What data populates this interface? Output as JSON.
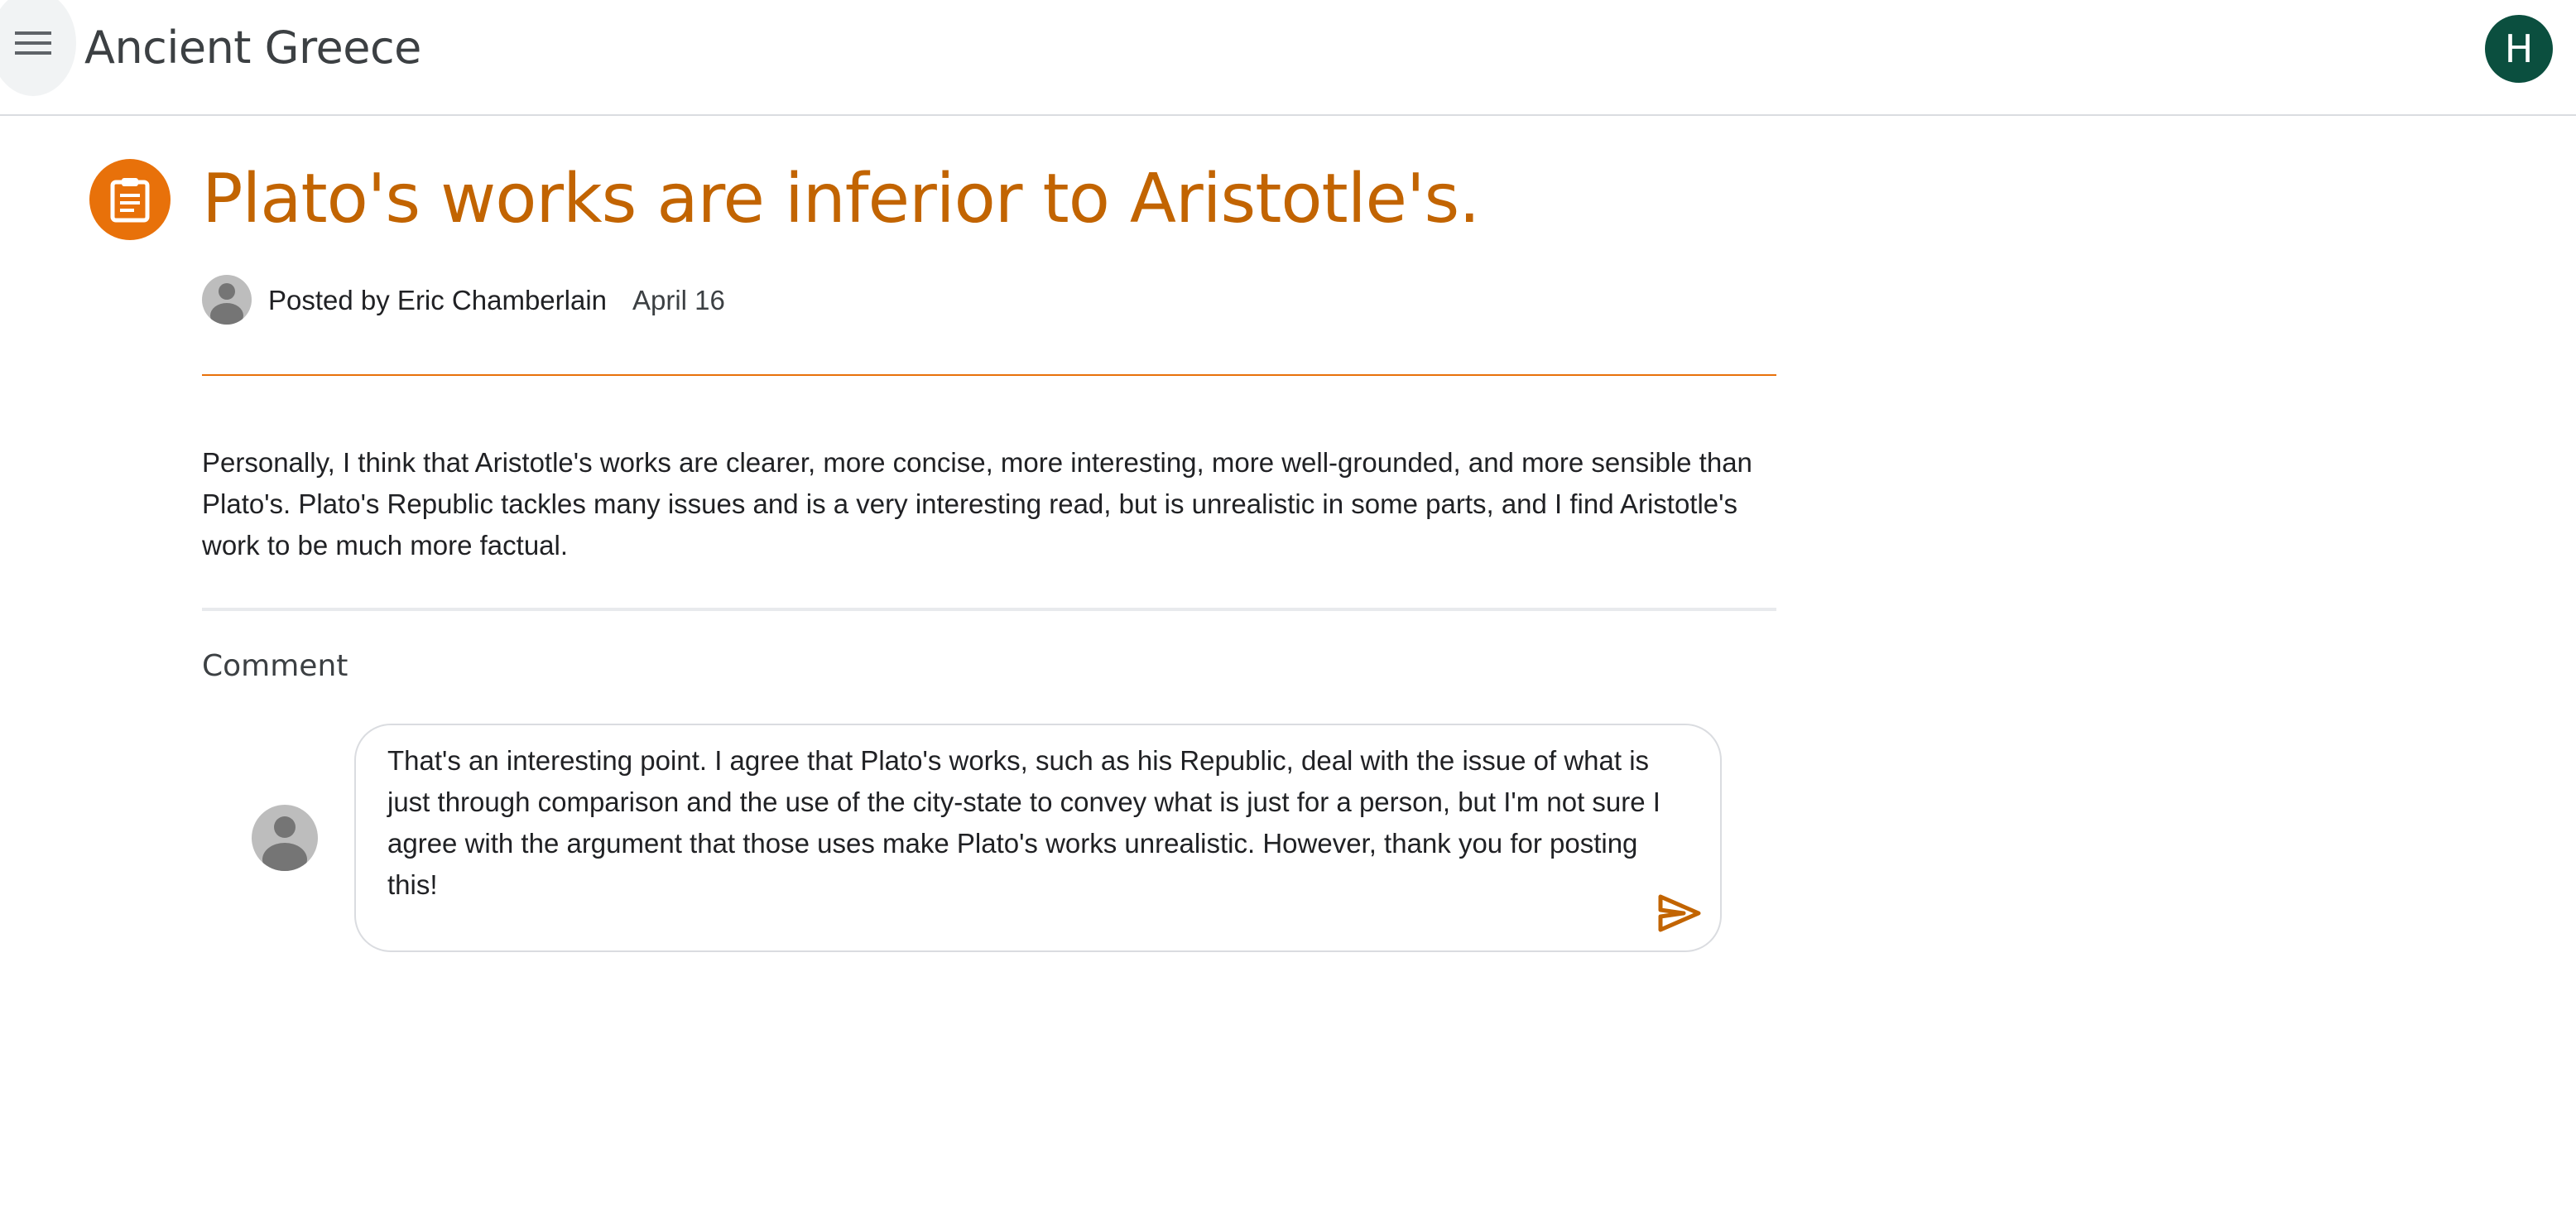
{
  "header": {
    "class_title": "Ancient Greece",
    "account_initial": "H"
  },
  "post": {
    "title": "Plato's works are inferior to Aristotle's.",
    "author_line": "Posted by Eric Chamberlain",
    "date": "April 16",
    "body": "Personally, I think that Aristotle's works are clearer, more concise, more interesting, more well-grounded, and more sensible than Plato's. Plato's Republic tackles many issues and is a very interesting read, but is unrealistic in some parts, and I find Aristotle's work to be much more factual."
  },
  "comment": {
    "label": "Comment",
    "draft_text": "That's an interesting point. I agree that Plato's works, such as his Republic, deal with the issue of what is just through comparison and the use of the city-state to convey what is just for a person, but I'm not sure I agree with the argument that those uses make Plato's works unrealistic. However, thank you for posting this!"
  },
  "icons": {
    "menu": "hamburger-menu-icon",
    "post_type": "assignment-clipboard-icon",
    "avatar": "person-placeholder-icon",
    "send": "send-paper-plane-icon"
  },
  "colors": {
    "accent": "#e8710a",
    "title": "#c26401",
    "account_avatar": "#0b4f3f",
    "divider": "#dadce0"
  }
}
